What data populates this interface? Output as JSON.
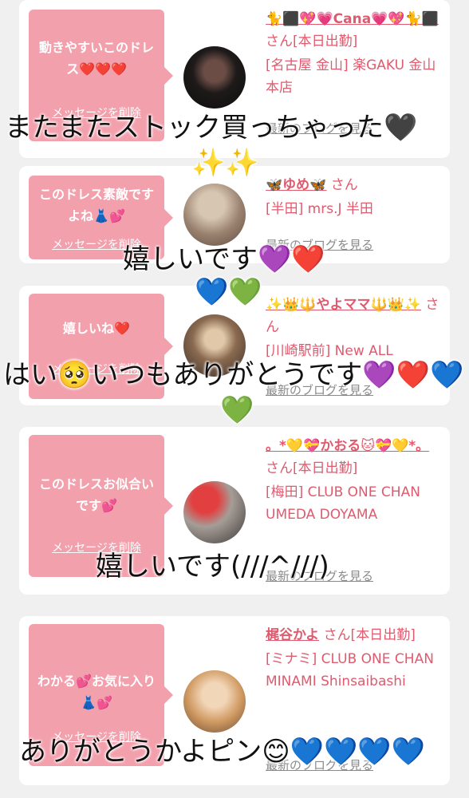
{
  "cards": [
    {
      "message": "動きやすいこのドレス❤️❤️❤️",
      "delete_label": "メッセージを削除",
      "name": "🐈⬛💖💗Cana💗💖🐈⬛",
      "suffix": "さん[本日出勤]",
      "shop": "[名古屋 金山] 楽GAKU 金山本店",
      "blog_label": "最新のブログを見る"
    },
    {
      "message": "このドレス素敵ですよね👗💕",
      "delete_label": "メッセージを削除",
      "name": "🦋ゆめ🦋",
      "suffix": "さん",
      "shop": "[半田] mrs.J 半田",
      "blog_label": "最新のブログを見る"
    },
    {
      "message": "嬉しいね❤️",
      "delete_label": "メッセージを削除",
      "name": "✨👑🔱やよママ🔱👑✨",
      "suffix": "さん",
      "shop": "[川崎駅前] New ALL",
      "blog_label": "最新のブログを見る"
    },
    {
      "message": "このドレスお似合いです💕",
      "delete_label": "メッセージを削除",
      "name": "。*💛💝かおる🐱💝💛*。",
      "suffix": "さん[本日出勤]",
      "shop": "[梅田] CLUB ONE CHAN UMEDA DOYAMA",
      "blog_label": "最新のブログを見る"
    },
    {
      "message": "わかる💕お気に入り👗💕",
      "delete_label": "メッセージを削除",
      "name": "梶谷かよ",
      "suffix": "さん[本日出勤]",
      "shop": "[ミナミ] CLUB ONE CHAN MINAMI Shinsaibashi",
      "blog_label": "最新のブログを見る"
    }
  ],
  "overlays": {
    "o1": "またまたストック買っちゃった🖤",
    "o1b": "✨✨",
    "o2": "嬉しいです💜❤️",
    "o2b": "💙💚",
    "o3": "はい🥺いつもありがとうです💜❤️💙",
    "o3b": "💚",
    "o4": "嬉しいです(///^///)",
    "o5": "ありがとうかよピン😊💙💙💙💙"
  },
  "colors": {
    "bubble": "#f3a0ad",
    "accent_text": "#e05a6e",
    "background": "#f1f0f1"
  }
}
